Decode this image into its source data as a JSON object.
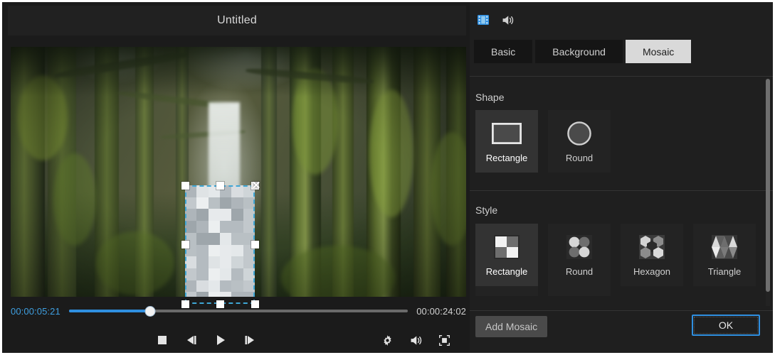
{
  "preview": {
    "title": "Untitled",
    "timecode_current": "00:00:05:21",
    "timecode_total": "00:00:24:02",
    "progress_percent": 24,
    "controls": [
      {
        "name": "stop-button",
        "icon": "stop-icon"
      },
      {
        "name": "previous-frame-button",
        "icon": "previous-frame-icon"
      },
      {
        "name": "play-button",
        "icon": "play-icon"
      },
      {
        "name": "next-frame-button",
        "icon": "next-frame-icon"
      }
    ],
    "controls_right": [
      {
        "name": "settings-button",
        "icon": "gear-icon"
      },
      {
        "name": "volume-button",
        "icon": "speaker-icon"
      },
      {
        "name": "fullscreen-button",
        "icon": "fullscreen-icon"
      }
    ],
    "selection": {
      "close_label": "✕",
      "handle_count": 8
    }
  },
  "panel": {
    "mode_icons": [
      {
        "name": "video-clip-icon",
        "active": true
      },
      {
        "name": "audio-speaker-icon",
        "active": false
      }
    ],
    "tabs": [
      {
        "label": "Basic",
        "active": false
      },
      {
        "label": "Background",
        "active": false
      },
      {
        "label": "Mosaic",
        "active": true
      }
    ],
    "shape": {
      "label": "Shape",
      "options": [
        {
          "label": "Rectangle",
          "icon": "rectangle-shape-icon",
          "selected": true
        },
        {
          "label": "Round",
          "icon": "round-shape-icon",
          "selected": false
        }
      ]
    },
    "style": {
      "label": "Style",
      "options": [
        {
          "label": "Rectangle",
          "icon": "mosaic-rectangle-icon",
          "selected": true
        },
        {
          "label": "Round",
          "icon": "mosaic-round-icon",
          "selected": false
        },
        {
          "label": "Hexagon",
          "icon": "mosaic-hexagon-icon",
          "selected": false
        },
        {
          "label": "Triangle",
          "icon": "mosaic-triangle-icon",
          "selected": false
        }
      ]
    },
    "footer": {
      "add_label": "Add Mosaic",
      "ok_label": "OK"
    }
  },
  "colors": {
    "accent_blue": "#2f8fe0",
    "selection_outline": "#3fa7d6",
    "panel_bg": "#1f1f1f",
    "tile_bg": "#232323",
    "tile_selected_bg": "#333333",
    "active_tab_bg": "#d9d9d9"
  }
}
